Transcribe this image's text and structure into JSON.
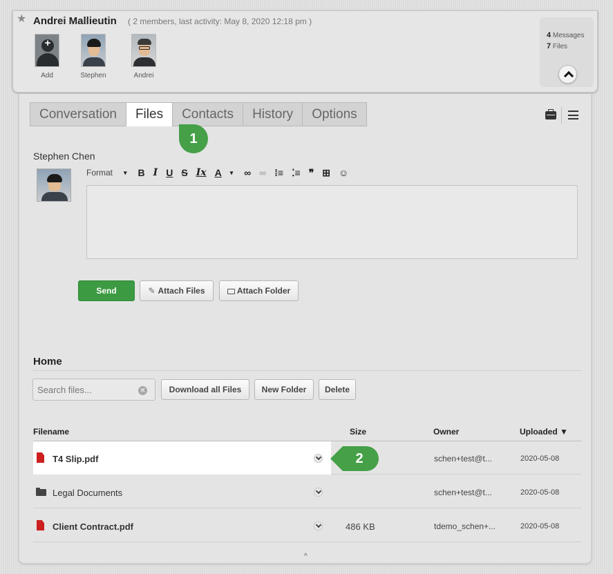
{
  "header": {
    "title": "Andrei Mallieutin",
    "meta": "( 2 members, last activity: May 8, 2020 12:18 pm )",
    "members": [
      {
        "label": "Add"
      },
      {
        "label": "Stephen"
      },
      {
        "label": "Andrei"
      }
    ],
    "stats": {
      "messages_count": "4",
      "messages_label": "Messages",
      "files_count": "7",
      "files_label": "Files"
    }
  },
  "tabs": [
    {
      "label": "Conversation",
      "active": false
    },
    {
      "label": "Files",
      "active": true
    },
    {
      "label": "Contacts",
      "active": false
    },
    {
      "label": "History",
      "active": false
    },
    {
      "label": "Options",
      "active": false
    }
  ],
  "badges": {
    "first": "1",
    "second": "2"
  },
  "composer": {
    "author": "Stephen Chen",
    "toolbar": {
      "format": "Format",
      "caret": "▾",
      "bold": "B",
      "italic": "I",
      "underline": "U",
      "strike": "S",
      "clear": "Ix",
      "color": "A",
      "color_caret": "▾",
      "link": "∞",
      "unlink": "∞",
      "numbered_list": "⁞≡",
      "bullet_list": "⁚≡",
      "quote": "❞",
      "table": "⊞",
      "emoji": "☺"
    },
    "send_label": "Send",
    "attach_files_label": "Attach Files",
    "attach_folder_label": "Attach Folder",
    "attach_files_icon": "✎"
  },
  "files": {
    "section_title": "Home",
    "search_placeholder": "Search files...",
    "clear_icon": "✕",
    "download_all_label": "Download all Files",
    "new_folder_label": "New Folder",
    "delete_label": "Delete",
    "columns": {
      "filename": "Filename",
      "size": "Size",
      "owner": "Owner",
      "uploaded": "Uploaded ▼"
    },
    "rows": [
      {
        "name": "T4 Slip.pdf",
        "type": "pdf",
        "size": "",
        "owner": "schen+test@t...",
        "uploaded": "2020-05-08"
      },
      {
        "name": "Legal Documents",
        "type": "folder",
        "size": "",
        "owner": "schen+test@t...",
        "uploaded": "2020-05-08"
      },
      {
        "name": "Client Contract.pdf",
        "type": "pdf",
        "size": "486 KB",
        "owner": "tdemo_schen+...",
        "uploaded": "2020-05-08"
      }
    ],
    "scroll_caret": "^"
  },
  "colors": {
    "accent_green": "#45a047",
    "send_green": "#3c9a42",
    "pdf_red": "#cc1f1f"
  }
}
